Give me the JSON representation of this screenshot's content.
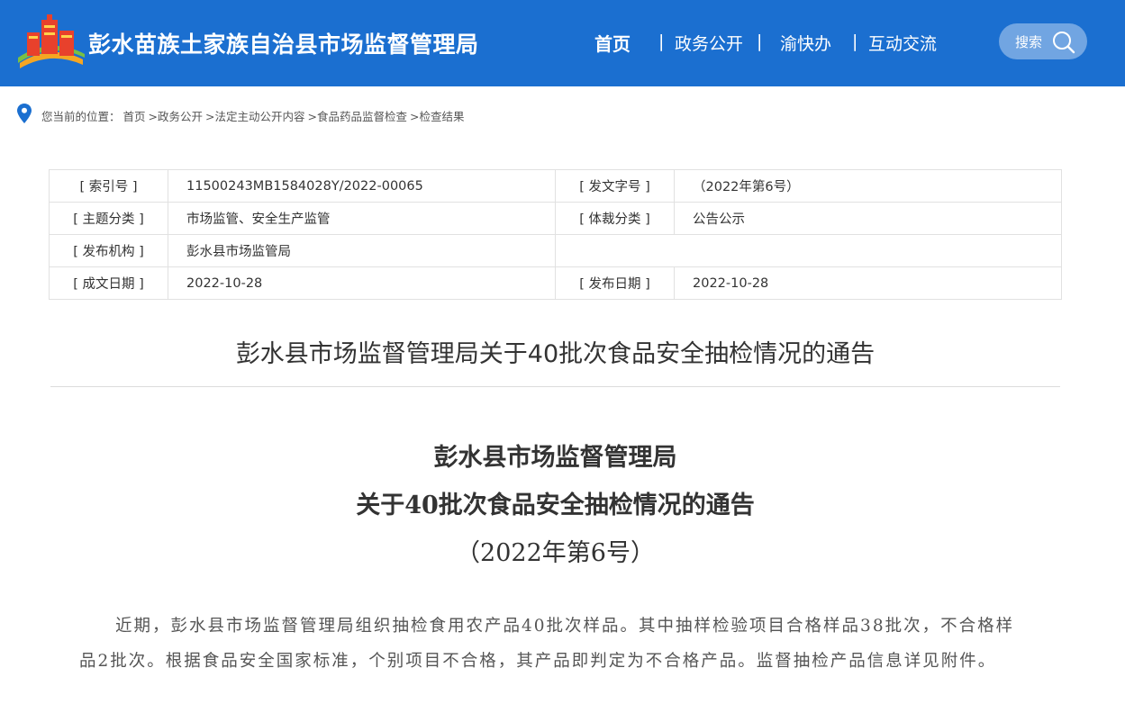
{
  "header": {
    "site_title": "彭水苗族土家族自治县市场监督管理局",
    "nav": {
      "home": "首页",
      "items": [
        "政务公开",
        "渝快办",
        "互动交流"
      ],
      "separator": "|"
    },
    "search_label": "搜索",
    "colors": {
      "background": "#1b6fd0",
      "text": "#ffffff"
    }
  },
  "breadcrumb": {
    "prefix": "您当前的位置：",
    "items": [
      "首页",
      ">政务公开",
      ">法定主动公开内容",
      ">食品药品监督检查",
      ">检查结果"
    ]
  },
  "meta": {
    "index_no_label": "[ 索引号 ]",
    "index_no": "11500243MB1584028Y/2022-00065",
    "doc_no_label": "[ 发文字号 ]",
    "doc_no": "（2022年第6号）",
    "topic_label": "[ 主题分类 ]",
    "topic": "市场监管、安全生产监管",
    "genre_label": "[ 体裁分类 ]",
    "genre": "公告公示",
    "publisher_label": "[ 发布机构 ]",
    "publisher": "彭水县市场监管局",
    "written_date_label": "[ 成文日期 ]",
    "written_date": "2022-10-28",
    "publish_date_label": "[ 发布日期 ]",
    "publish_date": "2022-10-28"
  },
  "article": {
    "title": "彭水县市场监督管理局关于40批次食品安全抽检情况的通告",
    "body_title_line1": "彭水县市场监督管理局",
    "body_title_line2": "关于40批次食品安全抽检情况的通告",
    "body_title_line3": "（2022年第6号）",
    "paragraph": "近期，彭水县市场监督管理局组织抽检食用农产品40批次样品。其中抽样检验项目合格样品38批次，不合格样品2批次。根据食品安全国家标准，个别项目不合格，其产品即判定为不合格产品。监督抽检产品信息详见附件。"
  }
}
